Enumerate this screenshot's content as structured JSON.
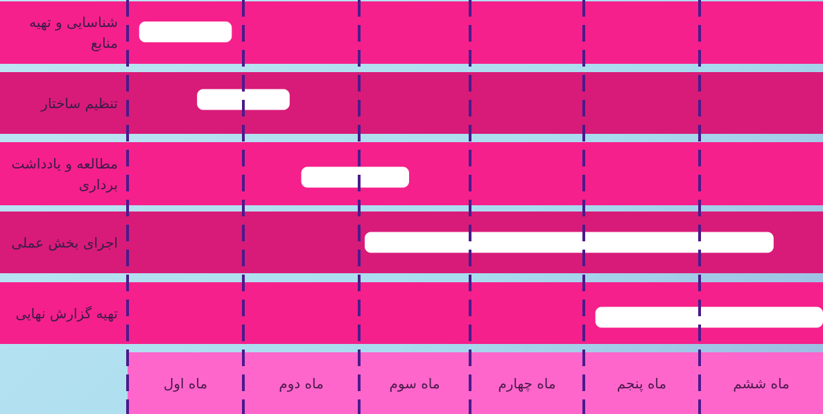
{
  "colors": {
    "row_light": "#f5208b",
    "row_dark": "#d81b78",
    "month_band": "#ff66cc",
    "bar": "#ffffff",
    "grid_line": "#4a1a8c"
  },
  "chart_data": {
    "type": "gantt",
    "months": [
      "ماه اول",
      "ماه دوم",
      "ماه سوم",
      "ماه چهارم",
      "ماه پنجم",
      "ماه ششم"
    ],
    "tasks": [
      {
        "label": "شناسایی و تهیه منابع",
        "start": 0.1,
        "end": 0.9
      },
      {
        "label": "تنظیم ساختار",
        "start": 0.6,
        "end": 1.4
      },
      {
        "label": "مطالعه و یادداشت برداری",
        "start": 1.5,
        "end": 2.45
      },
      {
        "label": "اجرای بخش عملی",
        "start": 2.05,
        "end": 5.6
      },
      {
        "label": "تهیه گزارش نهایی",
        "start": 4.1,
        "end": 6.0
      }
    ]
  }
}
